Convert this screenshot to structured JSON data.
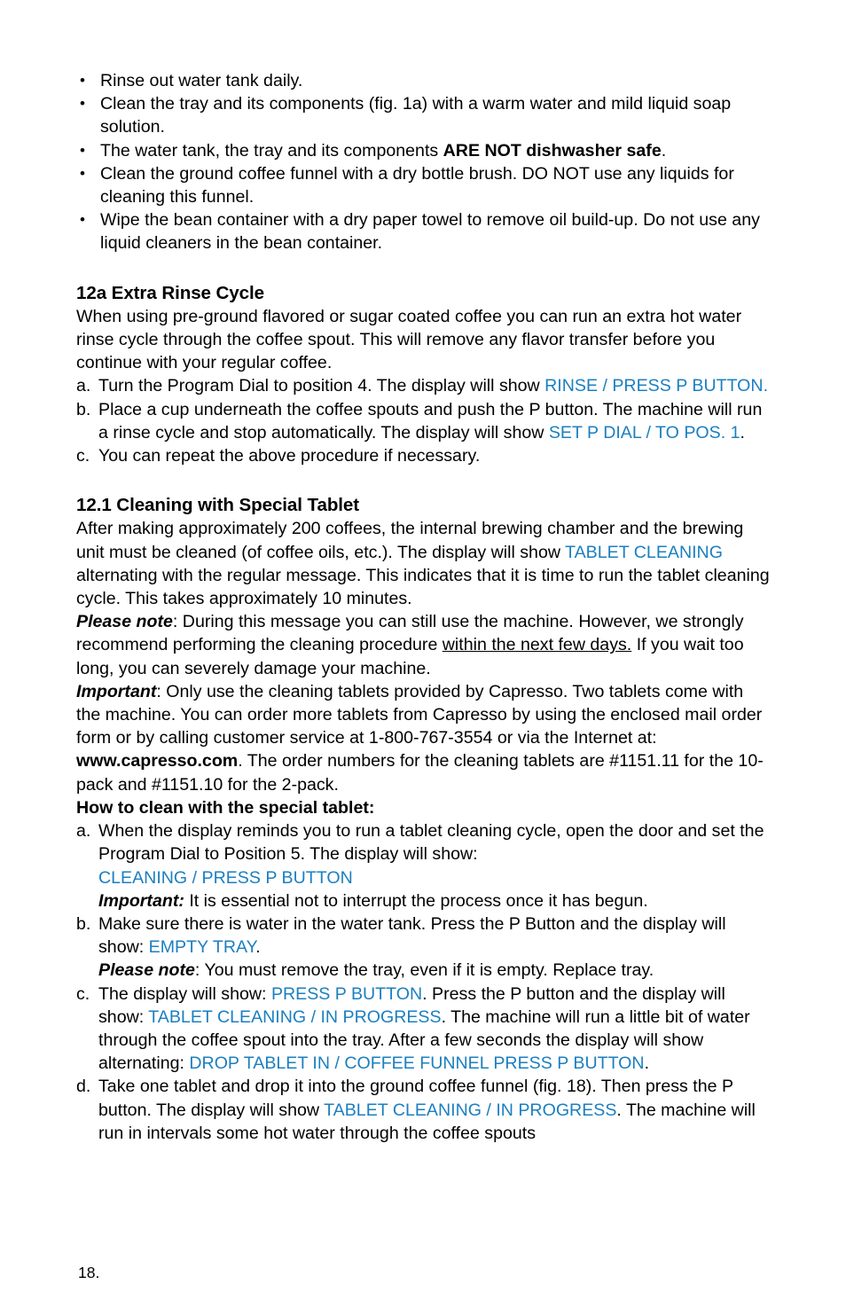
{
  "document": {
    "page_number": "18.",
    "colors": {
      "display_text": "#1b7fc0",
      "body_text": "#000000",
      "background": "#ffffff"
    }
  },
  "care_bullets": [
    {
      "text": "Rinse out water tank daily."
    },
    {
      "text": "Clean the tray and its components (fig. 1a) with a warm water and mild liquid soap solution."
    },
    {
      "pre": "The water tank, the tray and its components ",
      "bold": "ARE NOT dishwasher safe",
      "post": "."
    },
    {
      "text": "Clean the ground coffee funnel with a dry bottle brush. DO NOT use any liquids for cleaning this funnel."
    },
    {
      "text": "Wipe the bean container with a dry paper towel to remove oil build-up. Do not use any liquid cleaners in the bean container."
    }
  ],
  "section_12a": {
    "heading": "12a Extra Rinse Cycle",
    "intro": "When using pre-ground flavored or sugar coated coffee you can run an extra hot water rinse cycle through the coffee spout. This will remove any flavor transfer before you continue with your regular coffee.",
    "steps": {
      "a": {
        "marker": "a.",
        "pre": "Turn the Program Dial to position 4. The display will show ",
        "display": "RINSE / PRESS P BUTTON.",
        "post": ""
      },
      "b": {
        "marker": "b.",
        "pre": "Place a cup underneath the coffee spouts and push the P button. The machine will run a rinse cycle and stop automatically. The display will show ",
        "display": "SET P DIAL / TO POS. 1",
        "post": "."
      },
      "c": {
        "marker": "c.",
        "pre": "You can repeat the above procedure if necessary.",
        "display": "",
        "post": ""
      }
    }
  },
  "section_121": {
    "heading": "12.1 Cleaning with Special Tablet",
    "intro_part1": "After making approximately 200 coffees, the internal brewing chamber and the brewing unit must be cleaned (of coffee oils, etc.). The display will show ",
    "intro_display": "TABLET CLEANING",
    "intro_part2": " alternating with the regular message. This indicates that it is time to run the tablet cleaning cycle. This takes approximately 10 minutes.",
    "note_label": "Please note",
    "note_part1": ": During this message you can still use the machine. However, we strongly recommend performing the cleaning procedure ",
    "note_underlined": "within the next few days.",
    "note_part2": " If you wait too long, you can severely damage your machine.",
    "important_label": "Important",
    "important_part1": ": Only use the cleaning tablets provided by Capresso. Two tablets come with the machine. You can order more tablets from Capresso by using the enclosed mail order form or by calling customer service at 1-800-767-3554 or via the Internet at: ",
    "important_website": "www.capresso.com",
    "important_part2": ". The order numbers for the cleaning tablets are #1151.11 for the 10-pack and #1151.10 for the 2-pack.",
    "howto_heading": "How to clean with the special tablet:",
    "steps": {
      "a": {
        "marker": "a.",
        "text": "When the display reminds you to run a tablet cleaning cycle, open the door and set the Program Dial to Position 5. The display will show:",
        "display": "CLEANING / PRESS P BUTTON",
        "important_label": "Important:",
        "important_text": " It is essential not to interrupt the process once it has begun."
      },
      "b": {
        "marker": "b.",
        "pre": "Make sure there is water in the water tank. Press the P Button and the display will show: ",
        "display": "EMPTY TRAY",
        "post": ".",
        "note_label": "Please note",
        "note_text": ": You must remove the tray, even if it is empty. Replace tray."
      },
      "c": {
        "marker": "c.",
        "pre": "The display will show: ",
        "display1": "PRESS P BUTTON",
        "mid1": ". Press the P button and the display will show: ",
        "display2": "TABLET CLEANING / IN PROGRESS",
        "mid2": ". The machine will run a little bit of water through the coffee spout into the tray. After a few seconds the display will show alternating: ",
        "display3": "DROP TABLET IN / COFFEE FUNNEL PRESS P BUTTON",
        "post": "."
      },
      "d": {
        "marker": "d.",
        "pre": "Take one tablet and drop it into the ground coffee funnel (fig. 18). Then press the P button. The display will show ",
        "display": "TABLET CLEANING / IN PROGRESS",
        "post": ". The machine will run in intervals some hot water through the coffee spouts"
      }
    }
  }
}
